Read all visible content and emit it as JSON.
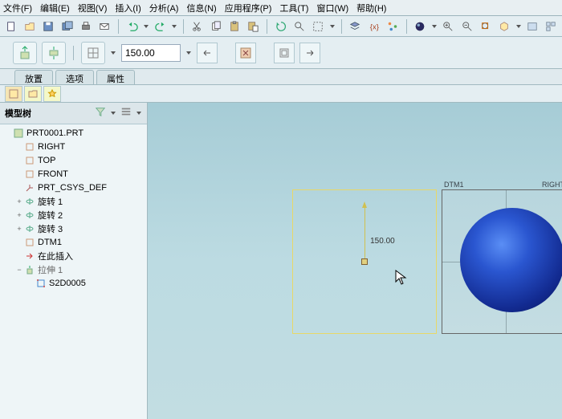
{
  "menu": {
    "file": "文件(F)",
    "edit": "编辑(E)",
    "view": "视图(V)",
    "insert": "插入(I)",
    "analyze": "分析(A)",
    "info": "信息(N)",
    "apps": "应用程序(P)",
    "tools": "工具(T)",
    "window": "窗口(W)",
    "help": "帮助(H)"
  },
  "sketch": {
    "value": "150.00",
    "dim_readout": "150.00"
  },
  "subtabs": {
    "place": "放置",
    "options": "选项",
    "props": "属性"
  },
  "tree": {
    "title": "模型树",
    "root": "PRT0001.PRT",
    "datum_right": "RIGHT",
    "datum_top": "TOP",
    "datum_front": "FRONT",
    "csys": "PRT_CSYS_DEF",
    "rev1": "旋转 1",
    "rev2": "旋转 2",
    "rev3": "旋转 3",
    "dtm1": "DTM1",
    "insert_here": "在此插入",
    "extrude": "拉伸 1",
    "sketch": "S2D0005"
  },
  "preview": {
    "dtm_label": "DTM1",
    "right_label": "RIGHT"
  }
}
